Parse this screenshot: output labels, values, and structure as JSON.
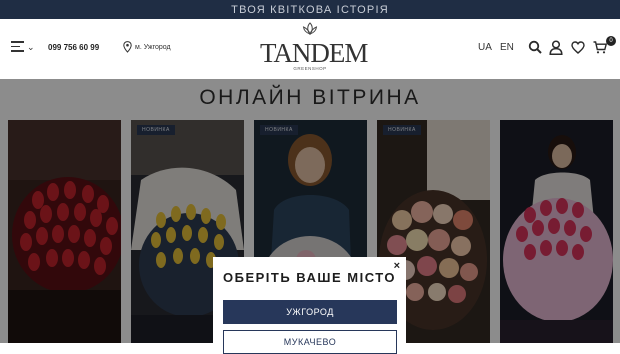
{
  "topbar": {
    "slogan": "ТВОЯ КВІТКОВА ІСТОРІЯ"
  },
  "header": {
    "phone": "099 756 60 99",
    "city": "м. Ужгород",
    "logo_text": "TANDEM",
    "logo_sub": "GREENSHOP",
    "languages": [
      "UA",
      "EN"
    ],
    "cart_count": "0",
    "icons": [
      "menu-icon",
      "chevron-down-icon",
      "location-pin-icon",
      "search-icon",
      "user-icon",
      "heart-icon",
      "cart-icon"
    ]
  },
  "main": {
    "title": "ОНЛАЙН ВІТРИНА",
    "products": [
      {
        "badge": ""
      },
      {
        "badge": "НОВИНКА"
      },
      {
        "badge": "НОВИНКА"
      },
      {
        "badge": "НОВИНКА"
      },
      {
        "badge": ""
      }
    ]
  },
  "modal": {
    "title": "ОБЕРІТЬ ВАШЕ МІСТО",
    "close": "×",
    "options": [
      "УЖГОРОД",
      "МУКАЧЕВО"
    ]
  },
  "colors": {
    "navy": "#1f2d44",
    "button": "#27375a"
  }
}
